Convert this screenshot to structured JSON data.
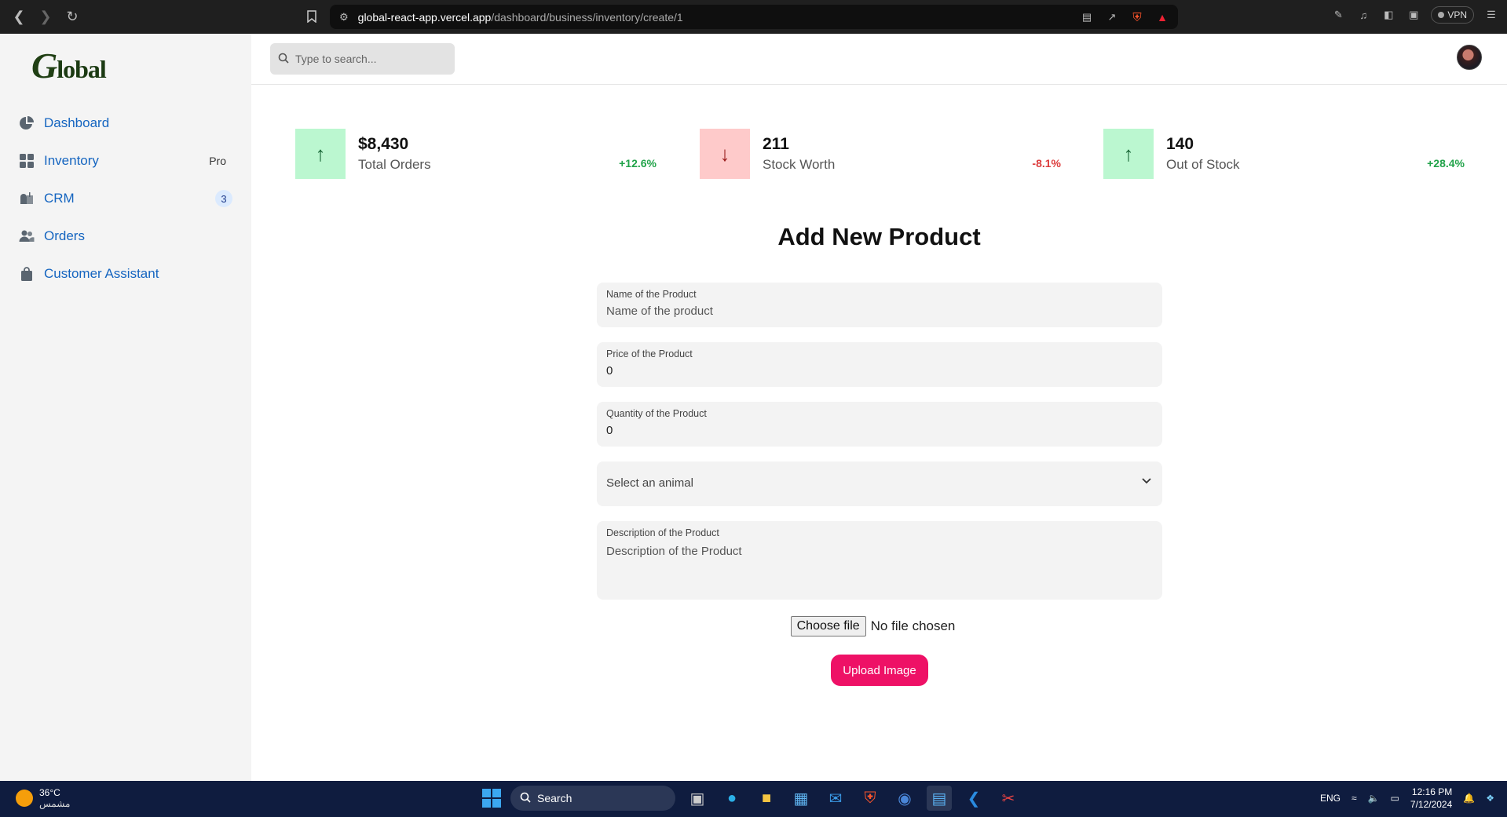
{
  "browser": {
    "url_domain": "global-react-app.vercel.app",
    "url_path": "/dashboard/business/inventory/create/1",
    "vpn_label": "VPN"
  },
  "sidebar": {
    "logo": "Global",
    "items": [
      {
        "label": "Dashboard",
        "icon": "pie-chart-icon"
      },
      {
        "label": "Inventory",
        "icon": "grid-icon",
        "tag": "Pro"
      },
      {
        "label": "CRM",
        "icon": "mailbox-icon",
        "badge": "3"
      },
      {
        "label": "Orders",
        "icon": "users-icon"
      },
      {
        "label": "Customer Assistant",
        "icon": "shopping-bag-icon"
      }
    ]
  },
  "topbar": {
    "search_placeholder": "Type to search..."
  },
  "stats": [
    {
      "value": "$8,430",
      "label": "Total Orders",
      "change": "+12.6%",
      "direction": "up"
    },
    {
      "value": "211",
      "label": "Stock Worth",
      "change": "-8.1%",
      "direction": "down"
    },
    {
      "value": "140",
      "label": "Out of Stock",
      "change": "+28.4%",
      "direction": "up"
    }
  ],
  "form": {
    "title": "Add New Product",
    "name_label": "Name of the Product",
    "name_placeholder": "Name of the product",
    "price_label": "Price of the Product",
    "price_value": "0",
    "quantity_label": "Quantity of the Product",
    "quantity_value": "0",
    "select_placeholder": "Select an animal",
    "description_label": "Description of the Product",
    "description_placeholder": "Description of the Product",
    "file_button": "Choose file",
    "file_status": "No file chosen",
    "upload_button": "Upload Image"
  },
  "taskbar": {
    "temperature": "36°C",
    "weather_desc": "مشمس",
    "search_label": "Search",
    "language": "ENG",
    "time": "12:16 PM",
    "date": "7/12/2024"
  },
  "colors": {
    "accent_link": "#1565c0",
    "upload_button": "#ee1166",
    "positive": "#22a34a",
    "negative": "#dc3c3c"
  }
}
